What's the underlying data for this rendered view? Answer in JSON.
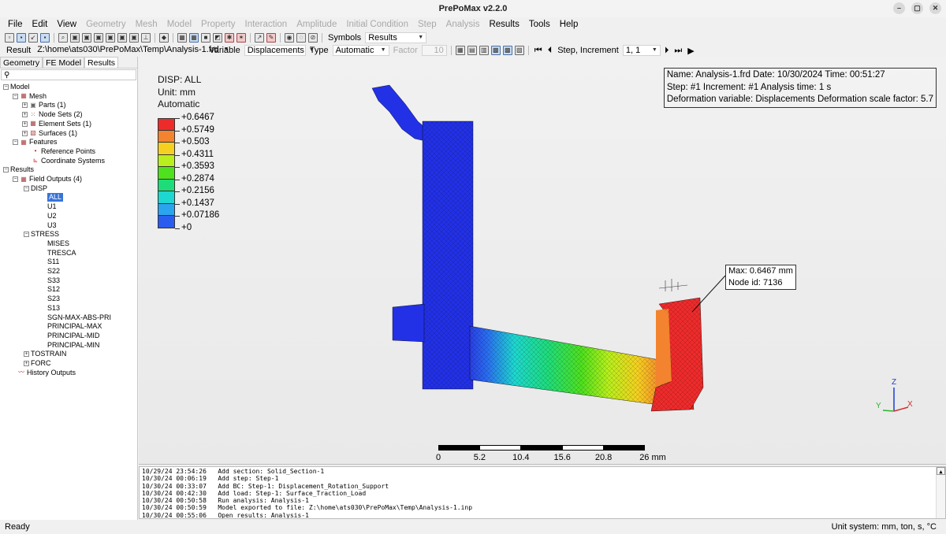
{
  "window": {
    "title": "PrePoMax v2.2.0"
  },
  "menu": [
    {
      "label": "File",
      "enabled": true
    },
    {
      "label": "Edit",
      "enabled": true
    },
    {
      "label": "View",
      "enabled": true
    },
    {
      "label": "Geometry",
      "enabled": false
    },
    {
      "label": "Mesh",
      "enabled": false
    },
    {
      "label": "Model",
      "enabled": false
    },
    {
      "label": "Property",
      "enabled": false
    },
    {
      "label": "Interaction",
      "enabled": false
    },
    {
      "label": "Amplitude",
      "enabled": false
    },
    {
      "label": "Initial Condition",
      "enabled": false
    },
    {
      "label": "Step",
      "enabled": false
    },
    {
      "label": "Analysis",
      "enabled": false
    },
    {
      "label": "Results",
      "enabled": true
    },
    {
      "label": "Tools",
      "enabled": true
    },
    {
      "label": "Help",
      "enabled": true
    }
  ],
  "toolbar1": {
    "symbols_label": "Symbols",
    "symbols_value": "Results"
  },
  "toolbar2": {
    "result_label": "Result",
    "result_path": "Z:\\home\\ats030\\PrePoMax\\Temp\\Analysis-1.frd",
    "variable_label": "Variable",
    "variable_value": "Displacements",
    "type_label": "Type",
    "type_value": "Automatic",
    "factor_label": "Factor",
    "factor_value": "10",
    "step_label": "Step, Increment",
    "step_value": "1, 1"
  },
  "tabs": [
    "Geometry",
    "FE Model",
    "Results"
  ],
  "tree": {
    "model": "Model",
    "mesh": "Mesh",
    "parts": "Parts (1)",
    "node_sets": "Node Sets (2)",
    "element_sets": "Element Sets (1)",
    "surfaces": "Surfaces (1)",
    "features": "Features",
    "reference_points": "Reference Points",
    "coordinate_systems": "Coordinate Systems",
    "results": "Results",
    "field_outputs": "Field Outputs (4)",
    "disp": "DISP",
    "disp_items": [
      "ALL",
      "U1",
      "U2",
      "U3"
    ],
    "stress": "STRESS",
    "stress_items": [
      "MISES",
      "TRESCA",
      "S11",
      "S22",
      "S33",
      "S12",
      "S23",
      "S13",
      "SGN-MAX-ABS-PRI",
      "PRINCIPAL-MAX",
      "PRINCIPAL-MID",
      "PRINCIPAL-MIN"
    ],
    "tostrain": "TOSTRAIN",
    "forc": "FORC",
    "history_outputs": "History Outputs"
  },
  "legend": {
    "title": "DISP: ALL",
    "unit": "Unit: mm",
    "mode": "Automatic",
    "ticks": [
      "+0.6467",
      "+0.5749",
      "+0.503",
      "+0.4311",
      "+0.3593",
      "+0.2874",
      "+0.2156",
      "+0.1437",
      "+0.07186",
      "+0"
    ],
    "colors": [
      "#ee2b2b",
      "#f3832e",
      "#f5d020",
      "#b8ef1c",
      "#4fe01e",
      "#1fdc7a",
      "#1ed7d0",
      "#2aa4ee",
      "#2a5cee"
    ]
  },
  "info": {
    "line1": "Name: Analysis-1.frd   Date: 10/30/2024   Time: 00:51:27",
    "line2": "Step: #1   Increment: #1   Analysis time: 1 s",
    "line3": "Deformation variable: Displacements   Deformation scale factor: 5.7"
  },
  "max_label": {
    "value": "Max: 0.6467 mm",
    "node": "Node id: 7136"
  },
  "scale_bar": {
    "labels": [
      "0",
      "5.2",
      "10.4",
      "15.6",
      "20.8",
      "26 mm"
    ]
  },
  "triad": {
    "x": "X",
    "y": "Y",
    "z": "Z"
  },
  "log": [
    "10/29/24 23:54:26   Add section: Solid_Section-1",
    "10/30/24 00:06:19   Add step: Step-1",
    "10/30/24 00:33:07   Add BC: Step-1: Displacement_Rotation_Support",
    "10/30/24 00:42:30   Add load: Step-1: Surface_Traction_Load",
    "10/30/24 00:50:58   Run analysis: Analysis-1",
    "10/30/24 00:50:59   Model exported to file: Z:\\home\\ats030\\PrePoMax\\Temp\\Analysis-1.inp",
    "10/30/24 00:55:06   Open results: Analysis-1"
  ],
  "status": {
    "left": "Ready",
    "right": "Unit system: mm, ton, s, °C"
  }
}
